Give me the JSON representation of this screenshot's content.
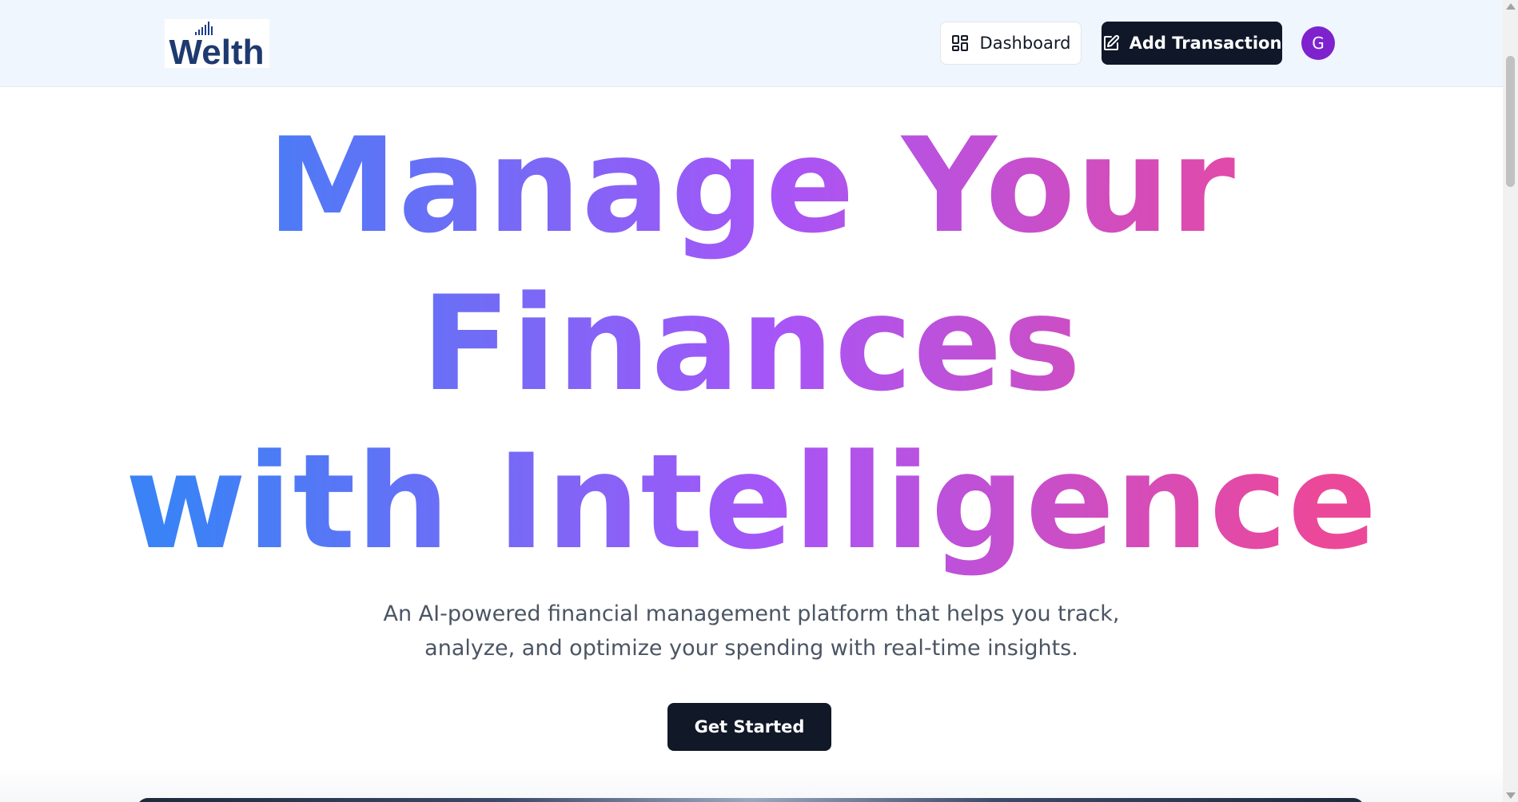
{
  "app": {
    "logo_text": "Welth"
  },
  "header": {
    "dashboard_label": "Dashboard",
    "add_transaction_label": "Add Transaction",
    "avatar_initial": "G"
  },
  "hero": {
    "title_lines": [
      "Manage Your",
      "Finances",
      "with Intelligence"
    ],
    "subtitle_lines": [
      "An AI-powered financial management platform that helps you track,",
      "analyze, and optimize your spending with real-time insights."
    ],
    "cta_label": "Get Started"
  },
  "colors": {
    "header_bg": "#f0f6fd",
    "primary_dark": "#0f1729",
    "avatar_bg": "#7e22ce",
    "gradient_start": "#3b82f6",
    "gradient_mid": "#a855f7",
    "gradient_end": "#ec4899",
    "subtitle_text": "#4b5563"
  },
  "icons": {
    "dashboard": "layout-dashboard-icon",
    "add_transaction": "pen-square-icon"
  }
}
